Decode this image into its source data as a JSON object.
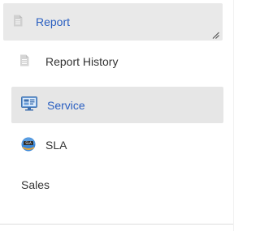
{
  "menu": {
    "report": {
      "label": "Report",
      "icon": "document-icon"
    },
    "items": [
      {
        "label": "Report History",
        "icon": "document-icon"
      },
      {
        "label": "Service",
        "icon": "service-monitor-icon"
      },
      {
        "label": "SLA",
        "icon": "sla-globe-icon"
      },
      {
        "label": "Sales"
      }
    ]
  },
  "colors": {
    "accent_text": "#2a5fc1",
    "active_bg": "#e6e6e6",
    "header_bg": "#e9e9e9",
    "text": "#333333",
    "icon_gray": "#c7c7c7"
  }
}
